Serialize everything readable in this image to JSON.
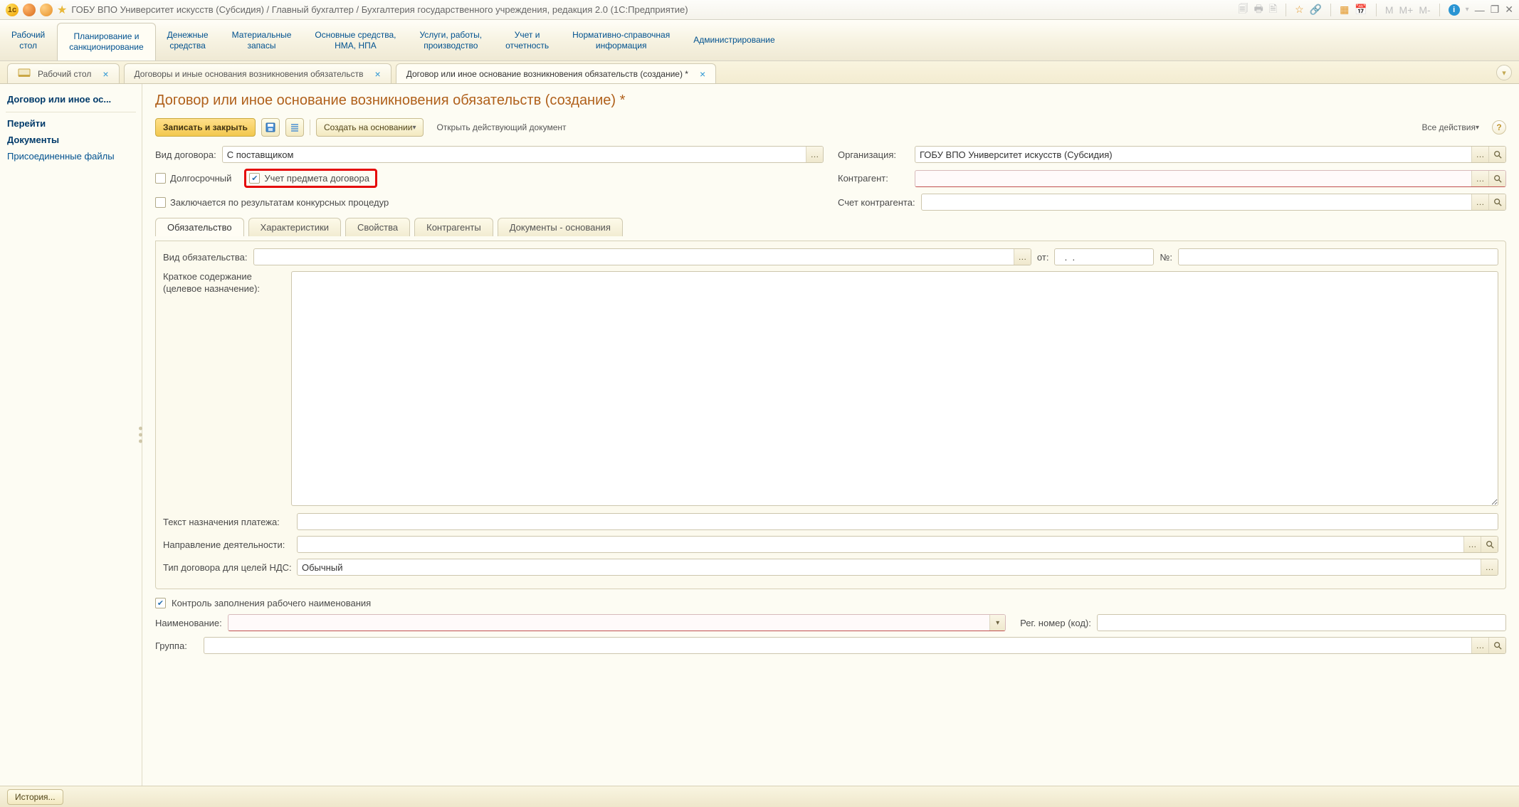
{
  "title_bar": {
    "title": "ГОБУ ВПО Университет искусств (Субсидия) / Главный бухгалтер / Бухгалтерия государственного учреждения, редакция 2.0  (1С:Предприятие)",
    "right_tokens": {
      "m": "M",
      "m_plus": "M+",
      "m_minus": "M-"
    }
  },
  "sections": [
    {
      "line1": "Рабочий",
      "line2": "стол"
    },
    {
      "line1": "Планирование и",
      "line2": "санкционирование"
    },
    {
      "line1": "Денежные",
      "line2": "средства"
    },
    {
      "line1": "Материальные",
      "line2": "запасы"
    },
    {
      "line1": "Основные средства,",
      "line2": "НМА, НПА"
    },
    {
      "line1": "Услуги, работы,",
      "line2": "производство"
    },
    {
      "line1": "Учет и",
      "line2": "отчетность"
    },
    {
      "line1": "Нормативно-справочная",
      "line2": "информация"
    },
    {
      "line1": "Администрирование",
      "line2": ""
    }
  ],
  "app_tabs": [
    {
      "label": "Рабочий стол",
      "active": false,
      "has_icon": true
    },
    {
      "label": "Договоры и иные основания возникновения обязательств",
      "active": false
    },
    {
      "label": "Договор или иное основание возникновения обязательств (создание) *",
      "active": true
    }
  ],
  "left_nav": {
    "item1": "Договор или иное ос...",
    "heading1": "Перейти",
    "item2": "Документы",
    "item3": "Присоединенные файлы"
  },
  "page_title": "Договор или иное основание возникновения обязательств (создание) *",
  "toolbar": {
    "save_close": "Записать и закрыть",
    "create_based": "Создать на основании",
    "open_active_doc": "Открыть действующий документ",
    "all_actions": "Все действия"
  },
  "form": {
    "contract_type_label": "Вид договора:",
    "contract_type_value": "С поставщиком",
    "org_label": "Организация:",
    "org_value": "ГОБУ ВПО Университет искусств (Субсидия)",
    "long_term_label": "Долгосрочный",
    "subject_tracking_label": "Учет предмета договора",
    "counterparty_label": "Контрагент:",
    "counterparty_value": "",
    "tender_label": "Заключается по результатам конкурсных процедур",
    "cp_account_label": "Счет контрагента:",
    "cp_account_value": ""
  },
  "inner_tabs": [
    "Обязательство",
    "Характеристики",
    "Свойства",
    "Контрагенты",
    "Документы - основания"
  ],
  "obligation": {
    "type_label": "Вид обязательства:",
    "type_value": "",
    "from_label": "от:",
    "from_value": "  .  .    ",
    "num_label": "№:",
    "num_value": "",
    "summary_label1": "Краткое содержание",
    "summary_label2": "(целевое назначение):",
    "summary_value": "",
    "payment_text_label": "Текст назначения платежа:",
    "payment_text_value": "",
    "activity_label": "Направление деятельности:",
    "activity_value": "",
    "vat_type_label": "Тип договора для целей НДС:",
    "vat_type_value": "Обычный"
  },
  "footer": {
    "control_label": "Контроль заполнения рабочего наименования",
    "name_label": "Наименование:",
    "name_value": "",
    "reg_label": "Рег. номер (код):",
    "reg_value": "",
    "group_label": "Группа:",
    "group_value": ""
  },
  "status_bar": {
    "history": "История..."
  }
}
